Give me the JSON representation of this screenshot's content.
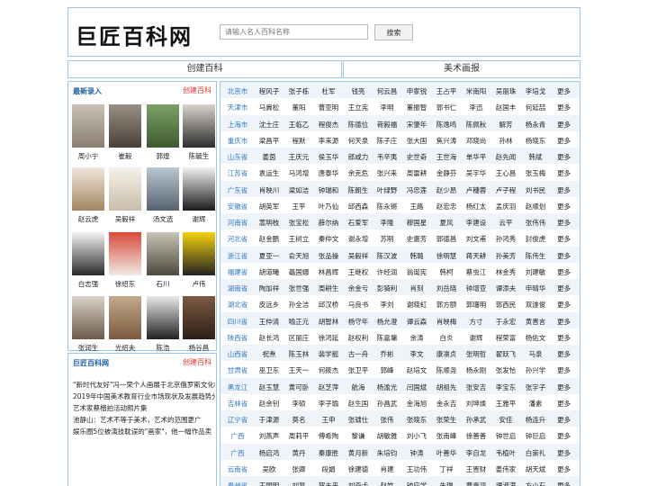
{
  "header": {
    "logo": "巨匠百科网",
    "search_placeholder": "请输入名人百科名称",
    "search_button": "搜索"
  },
  "tabs": [
    "创建百科",
    "美术画报"
  ],
  "latest": {
    "title": "最新录入",
    "link": "创建百科",
    "people": [
      "周小宁",
      "崔毅",
      "郭煌",
      "陈毓生",
      "赵云虎",
      "吴毅祥",
      "汤文选",
      "谢辉",
      "白志强",
      "徐绍东",
      "石川",
      "卢伟",
      "张润生",
      "光绍夫",
      "陈浩",
      "杨谷昌"
    ]
  },
  "news_box": {
    "title": "巨匠百科网",
    "link": "创建百科",
    "items": [
      "\"新时代友好\"冯一荣个人画展于北京俄罗斯文化中",
      "2019年中国美术教育行业市场现状及发展趋势分",
      "艺术家蔡楷拍活动照片集",
      "池静山：艺术不等于美术，艺术的范围更广",
      "娱乐圈5位被演技耽误的\"画家\"，他一幅作品卖"
    ]
  },
  "more_label": "更多",
  "regions": [
    {
      "region": "北京市",
      "names": [
        "程风子",
        "张子栋",
        "杜军",
        "钱亮",
        "何云昌",
        "申家锐",
        "王占平",
        "米南阳",
        "吴丽珠",
        "李培戈"
      ]
    },
    {
      "region": "天津市",
      "names": [
        "马冀松",
        "董阳",
        "曹亚明",
        "王立宪",
        "李明",
        "董振智",
        "郭书仁",
        "李迅",
        "赵国丰",
        "何延喆"
      ]
    },
    {
      "region": "上海市",
      "names": [
        "沈士庄",
        "王临乙",
        "程俊杰",
        "陈德位",
        "荷毅福",
        "宋肇年",
        "陈逸鸣",
        "陈佩秋",
        "解芳",
        "杨永青"
      ]
    },
    {
      "region": "重庆市",
      "names": [
        "梁昌平",
        "程默",
        "李来源",
        "何天泉",
        "陈子庄",
        "张大国",
        "焦兴涛",
        "邓晓尚",
        "孙林",
        "杨晓东"
      ]
    },
    {
      "region": "山东省",
      "names": [
        "姜茵",
        "王庆元",
        "侯玉华",
        "郎咸力",
        "韦辛夷",
        "史世奇",
        "王世海",
        "单华平",
        "赵先闻",
        "韩斌"
      ]
    },
    {
      "region": "江苏省",
      "names": [
        "袁运生",
        "马鸿增",
        "唐泰华",
        "余克危",
        "张兴来",
        "周雷耕",
        "金静芬",
        "吴宇华",
        "王心昌",
        "张玉梅"
      ]
    },
    {
      "region": "广东省",
      "names": [
        "肖映川",
        "梁如洁",
        "钟瑞和",
        "陈朗生",
        "叶绿野",
        "冯忠莲",
        "赵少昂",
        "卢穗蓉",
        "卢子程",
        "刘书民"
      ]
    },
    {
      "region": "安徽省",
      "names": [
        "胡英军",
        "王平",
        "叶乃仙",
        "邱西森",
        "陈永锵",
        "王路",
        "赵宏忠",
        "杨红太",
        "孟庆羽",
        "赵顺划"
      ]
    },
    {
      "region": "河南省",
      "names": [
        "蒿明枝",
        "张宝松",
        "薛尔纳",
        "石爱军",
        "李隆",
        "穆国星",
        "夏风",
        "李建设",
        "云平",
        "张伟伟"
      ]
    },
    {
      "region": "河北省",
      "names": [
        "赵金鹏",
        "王树立",
        "秦仲文",
        "谢永增",
        "苏明",
        "史惠芳",
        "郭德昌",
        "刘文甫",
        "孙鸿秀",
        "封俊虎"
      ]
    },
    {
      "region": "浙江省",
      "names": [
        "夏亚一",
        "俞天旭",
        "张品操",
        "吴毅祥",
        "陈汉波",
        "韩璐",
        "徐明慧",
        "蒋天耕",
        "孙美芳",
        "陈伟生"
      ]
    },
    {
      "region": "福建省",
      "names": [
        "胡道曦",
        "聶国娜",
        "林昌辉",
        "王继权",
        "许经润",
        "翁诞宪",
        "韩柯",
        "蔡虫江",
        "林金秀",
        "刘建敏"
      ]
    },
    {
      "region": "湖南省",
      "names": [
        "陶加祥",
        "张世强",
        "周耕生",
        "余金亏",
        "彭猗利",
        "肖刻",
        "刘岳晓",
        "钟增亚",
        "谭添夫",
        "申晴华"
      ]
    },
    {
      "region": "湖北省",
      "names": [
        "皮远乡",
        "孙全洁",
        "邱汉桥",
        "马良书",
        "李刘",
        "谢晓虹",
        "郭方颐",
        "郭珊明",
        "郭西民",
        "双遂俊"
      ]
    },
    {
      "region": "四川省",
      "names": [
        "王仲清",
        "喻正元",
        "胡智林",
        "杨守年",
        "杨允澄",
        "谭云森",
        "肖映梅",
        "方寸",
        "于永宏",
        "黄晋言"
      ]
    },
    {
      "region": "陕西省",
      "names": [
        "赵长鸿",
        "区丽庄",
        "徐鸿延",
        "赵权利",
        "陈嘉墉",
        "余涛",
        "白炎",
        "谢辉",
        "程荣富",
        "杨佑文"
      ]
    },
    {
      "region": "山西省",
      "names": [
        "祝焘",
        "陈玉林",
        "裴学懿",
        "古一舟",
        "乔彬",
        "李文",
        "康凛贞",
        "张明哲",
        "翟跃飞",
        "马泉"
      ]
    },
    {
      "region": "甘肃省",
      "names": [
        "巫卫东",
        "王天一",
        "何筱杰",
        "张卫平",
        "郭峰",
        "赵培文",
        "陈顺尧",
        "杨永刚",
        "张发恰",
        "孙兴学"
      ]
    },
    {
      "region": "黑龙江",
      "names": [
        "赵玉慧",
        "黄可卧",
        "赵芝萍",
        "航海",
        "杨渝光",
        "闫国斌",
        "胡祖先",
        "张安吉",
        "李宝东",
        "张宇子"
      ]
    },
    {
      "region": "吉林省",
      "names": [
        "赵余钊",
        "李硕",
        "李子瑜",
        "赵生国",
        "孙昌武",
        "金海旭",
        "金永吉",
        "刘坤焕",
        "王雅平",
        "潘素"
      ]
    },
    {
      "region": "辽宁省",
      "names": [
        "于津源",
        "莫名",
        "王申",
        "张骕仕",
        "张伟",
        "张晓东",
        "张荣生",
        "孙承武",
        "安佳",
        "杨连升"
      ]
    },
    {
      "region": "广西",
      "names": [
        "刘燕声",
        "周莉平",
        "傅希陶",
        "黎谦",
        "胡敏雅",
        "刘小飞",
        "张南峰",
        "徐善善",
        "钟世启",
        "钟巨启"
      ]
    },
    {
      "region": "广西",
      "names": [
        "杨启鸿",
        "黄丹",
        "秦康胜",
        "黄月新",
        "朱培钧",
        "钟涛",
        "叶善华",
        "李自龙",
        "韦植叶",
        "白崇礼"
      ]
    },
    {
      "region": "云南省",
      "names": [
        "吴欧",
        "张卿",
        "段娟",
        "徐建德",
        "肖建",
        "王功伟",
        "丁祥",
        "王晋财",
        "姜伟家",
        "胡天斌"
      ]
    },
    {
      "region": "贵州省",
      "names": [
        "王园明",
        "刘复",
        "贺未来",
        "刘奇卡",
        "赵竹",
        "钟应学",
        "朱瑞",
        "曹贵鸿",
        "谭淑满",
        "方小石"
      ]
    }
  ]
}
